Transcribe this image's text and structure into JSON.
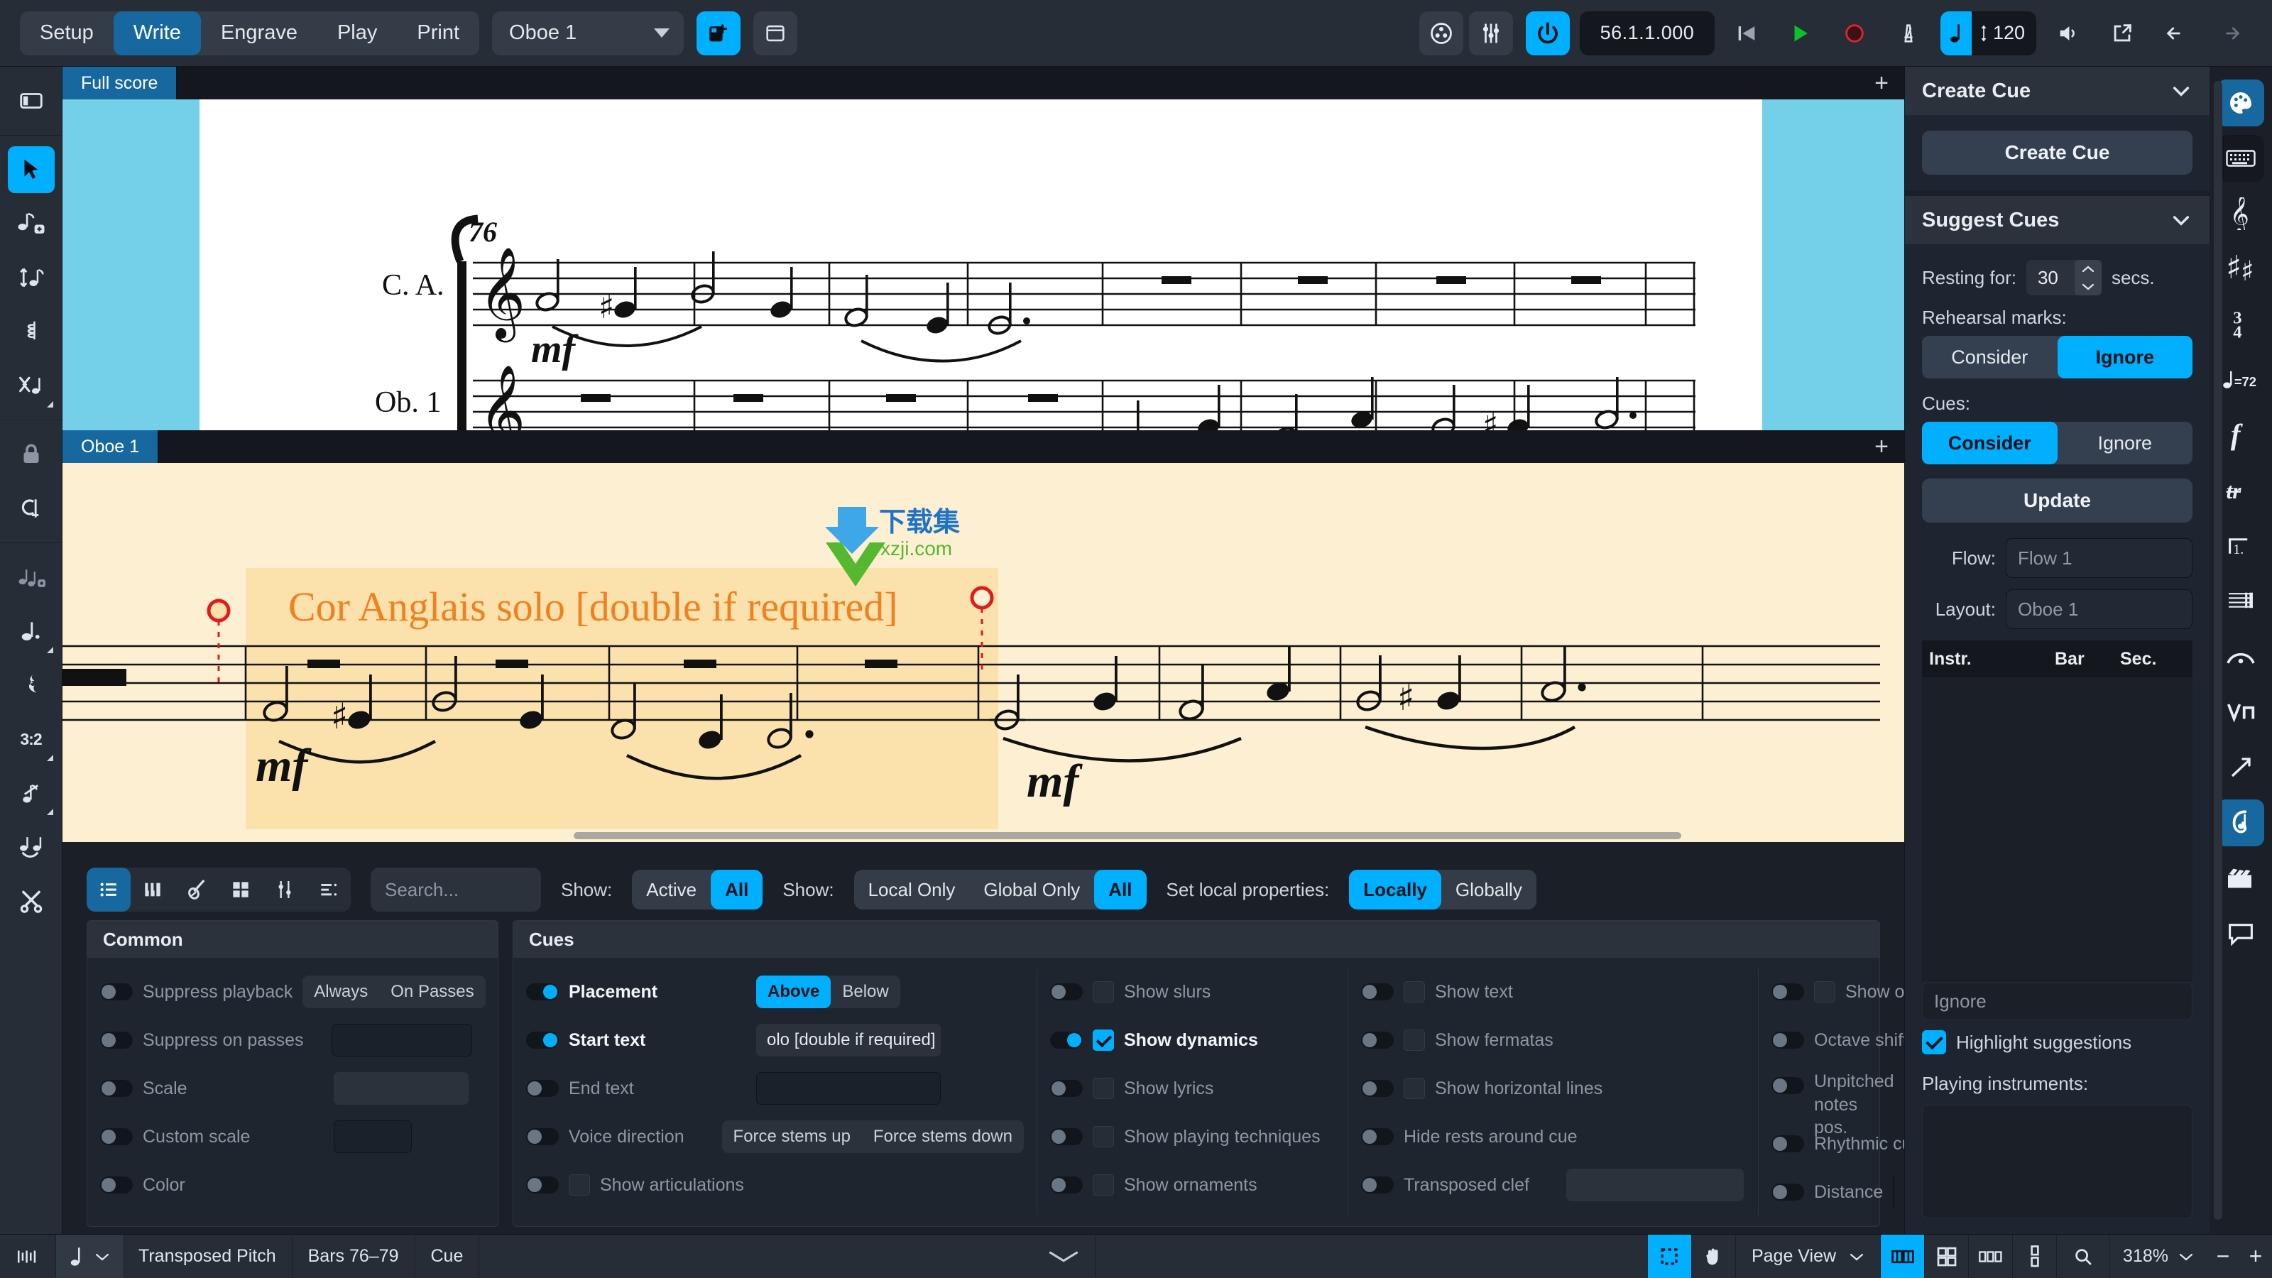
{
  "toolbar": {
    "modes": [
      {
        "label": "Setup",
        "active": false
      },
      {
        "label": "Write",
        "active": true
      },
      {
        "label": "Engrave",
        "active": false
      },
      {
        "label": "Play",
        "active": false
      },
      {
        "label": "Print",
        "active": false
      }
    ],
    "instrument_selector": "Oboe 1",
    "icons": {
      "new_tab": "new-tab-icon",
      "window": "window-icon",
      "mixer": "mixer-reel-icon",
      "faders": "faders-icon",
      "power": "playback-power-icon",
      "rewind": "rewind-icon",
      "play": "play-icon",
      "record": "record-icon",
      "metronome": "metronome-icon",
      "volume": "volume-icon",
      "export": "export-icon",
      "undo": "undo-icon",
      "redo": "redo-icon"
    },
    "timecode": "56.1.1.000",
    "tempo": "120"
  },
  "left_toolbar": {
    "items": [
      {
        "name": "panel-toggle-icon",
        "label": "Show left panel",
        "active": false
      },
      {
        "name": "select-arrow-icon",
        "label": "Select tool",
        "active": true
      },
      {
        "name": "note-input-icon",
        "label": "Note input",
        "active": false
      },
      {
        "name": "pitch-adjust-icon",
        "label": "Pitch before duration",
        "active": false
      },
      {
        "name": "chord-icon",
        "label": "Chord mode",
        "active": false
      },
      {
        "name": "voice-icon",
        "label": "Voice",
        "active": false
      },
      {
        "name": "lock-duration-icon",
        "label": "Lock duration",
        "active": false
      },
      {
        "name": "insert-icon",
        "label": "Insert mode",
        "active": false
      },
      {
        "name": "grace-note-icon",
        "label": "Grace note",
        "active": false
      },
      {
        "name": "dotted-note-icon",
        "label": "Note duration",
        "active": false
      },
      {
        "name": "rest-icon",
        "label": "Rest",
        "active": false
      },
      {
        "name": "tuplet-icon",
        "label": "3:2",
        "active": false
      },
      {
        "name": "slashed-grace-icon",
        "label": "Slashed grace note",
        "active": false
      },
      {
        "name": "tie-icon",
        "label": "Tie notes",
        "active": false
      },
      {
        "name": "scissors-icon",
        "label": "Split/cut",
        "active": false
      }
    ],
    "tuplet_label": "3:2"
  },
  "score_panes": [
    {
      "tab": "Full score",
      "staves": [
        {
          "name": "C. A.",
          "label": "Cor Anglais"
        },
        {
          "name": "Ob. 1",
          "label": "Oboe 1"
        }
      ],
      "bar_number": "76",
      "dynamics": [
        "mf",
        "mf"
      ],
      "selection_color": "#74cfe8"
    },
    {
      "tab": "Oboe 1",
      "cue_text": "Cor Anglais solo [double if required]",
      "cue_text_color": "#f08020",
      "dynamics": [
        "mf",
        "mf"
      ],
      "highlight_color": "#fdf0d2",
      "cue_highlight_color": "#fbe2ad",
      "watermark": {
        "cn": "下载集",
        "url": "xzji.com"
      }
    }
  ],
  "properties_toolbar": {
    "filter_icons": [
      {
        "name": "list-view-icon",
        "active": true
      },
      {
        "name": "piano-keys-icon",
        "active": false
      },
      {
        "name": "guitar-icon",
        "active": false
      },
      {
        "name": "grid-view-icon",
        "active": false
      },
      {
        "name": "faders-icon",
        "active": false
      },
      {
        "name": "outline-icon",
        "active": false
      }
    ],
    "search_placeholder": "Search...",
    "show_label_1": "Show:",
    "show_group_1": [
      {
        "label": "Active",
        "on": false
      },
      {
        "label": "All",
        "on": true
      }
    ],
    "show_label_2": "Show:",
    "show_group_2": [
      {
        "label": "Local Only",
        "on": false
      },
      {
        "label": "Global Only",
        "on": false
      },
      {
        "label": "All",
        "on": true
      }
    ],
    "set_local_label": "Set local properties:",
    "set_local_group": [
      {
        "label": "Locally",
        "on": true
      },
      {
        "label": "Globally",
        "on": false
      }
    ]
  },
  "common_panel": {
    "title": "Common",
    "rows": [
      {
        "label": "Suppress playback",
        "on": false,
        "control": "segmented",
        "options": [
          "Always",
          "On Passes"
        ]
      },
      {
        "label": "Suppress on passes",
        "on": false,
        "control": "field",
        "value": ""
      },
      {
        "label": "Scale",
        "on": false,
        "control": "fieldfill",
        "value": ""
      },
      {
        "label": "Custom scale",
        "on": false,
        "control": "fieldsm",
        "value": ""
      },
      {
        "label": "Color",
        "on": false,
        "control": "none",
        "value": ""
      }
    ]
  },
  "cues_panel": {
    "title": "Cues",
    "col1": [
      {
        "label": "Placement",
        "on": true,
        "control": "segmented",
        "options": [
          "Above",
          "Below"
        ],
        "selected": "Above"
      },
      {
        "label": "Start text",
        "on": true,
        "control": "textfield",
        "value": "olo [double if required]"
      },
      {
        "label": "End text",
        "on": false,
        "control": "field",
        "value": ""
      },
      {
        "label": "Voice direction",
        "on": false,
        "control": "segmented",
        "options": [
          "Force stems up",
          "Force stems down"
        ],
        "selected": ""
      },
      {
        "label": "Show articulations",
        "on": false,
        "control": "checkbox",
        "checked": false
      }
    ],
    "col2": [
      {
        "label": "Show slurs",
        "on": false,
        "checked": false
      },
      {
        "label": "Show dynamics",
        "on": true,
        "checked": true
      },
      {
        "label": "Show lyrics",
        "on": false,
        "checked": false
      },
      {
        "label": "Show playing techniques",
        "on": false,
        "checked": false
      },
      {
        "label": "Show ornaments",
        "on": false,
        "checked": false
      }
    ],
    "col3": [
      {
        "label": "Show text",
        "on": false,
        "checked": false,
        "has_checkbox": true
      },
      {
        "label": "Show fermatas",
        "on": false,
        "checked": false,
        "has_checkbox": true
      },
      {
        "label": "Show horizontal lines",
        "on": false,
        "checked": false,
        "has_checkbox": true
      },
      {
        "label": "Hide rests around cue",
        "on": false,
        "has_checkbox": false
      },
      {
        "label": "Transposed clef",
        "on": false,
        "has_checkbox": false,
        "control": "fieldfill"
      }
    ],
    "col4": [
      {
        "label": "Show octave transp",
        "on": false,
        "checked": false,
        "has_checkbox": true
      },
      {
        "label": "Octave shift",
        "on": false,
        "has_checkbox": false,
        "control": "field"
      },
      {
        "label": "Unpitched notes pos.",
        "on": false,
        "has_checkbox": false,
        "control": "field"
      },
      {
        "label": "Rhythmic cue",
        "on": false,
        "has_checkbox": false
      },
      {
        "label": "Distance",
        "on": false,
        "has_checkbox": false,
        "control": "field"
      }
    ]
  },
  "right_panel": {
    "create_cue": {
      "title": "Create Cue",
      "button": "Create Cue"
    },
    "suggest_cues": {
      "title": "Suggest Cues",
      "resting_label": "Resting for:",
      "resting_value": "30",
      "resting_unit": "secs.",
      "rehearsal_label": "Rehearsal marks:",
      "rehearsal_options": [
        {
          "label": "Consider",
          "on": false
        },
        {
          "label": "Ignore",
          "on": true
        }
      ],
      "cues_label": "Cues:",
      "cues_options": [
        {
          "label": "Consider",
          "on": true
        },
        {
          "label": "Ignore",
          "on": false
        }
      ],
      "update_button": "Update",
      "flow_label": "Flow:",
      "flow_value": "Flow 1",
      "layout_label": "Layout:",
      "layout_value": "Oboe 1",
      "table_headers": [
        "Instr.",
        "Bar",
        "Sec."
      ],
      "table_rows": [],
      "ignore_field": "Ignore",
      "highlight_label": "Highlight suggestions",
      "highlight_checked": true,
      "playing_label": "Playing instruments:"
    }
  },
  "right_rail": {
    "items": [
      {
        "name": "palette-icon",
        "active": true
      },
      {
        "name": "keyboard-icon",
        "active": false,
        "dark": true
      },
      {
        "name": "clef-icon",
        "active": false
      },
      {
        "name": "key-signature-icon",
        "active": false
      },
      {
        "name": "time-signature-icon",
        "active": false
      },
      {
        "name": "tempo-icon",
        "active": false,
        "label": "=72"
      },
      {
        "name": "dynamics-icon",
        "active": false
      },
      {
        "name": "ornaments-icon",
        "active": false
      },
      {
        "name": "repeat-structures-icon",
        "active": false
      },
      {
        "name": "barlines-icon",
        "active": false
      },
      {
        "name": "slurs-icon",
        "active": false
      },
      {
        "name": "playing-techniques-icon",
        "active": false
      },
      {
        "name": "lines-icon",
        "active": false
      },
      {
        "name": "cues-icon",
        "active": true
      },
      {
        "name": "video-icon",
        "active": false
      },
      {
        "name": "comments-icon",
        "active": false
      }
    ]
  },
  "status_bar": {
    "pitch_icon": "note-ruler-icon",
    "note_value_icon": "quarter-note-icon",
    "transposed_pitch": "Transposed Pitch",
    "bars": "Bars 76–79",
    "selection_type": "Cue",
    "marquee_icon": "marquee-select-icon",
    "hand_icon": "hand-tool-icon",
    "view_mode": "Page View",
    "layout_icons": [
      {
        "name": "spreads-view-icon",
        "active": true
      },
      {
        "name": "two-by-two-view-icon",
        "active": false
      },
      {
        "name": "horizontal-view-icon",
        "active": false
      },
      {
        "name": "vertical-view-icon",
        "active": false
      }
    ],
    "zoom_icon": "magnifier-icon",
    "zoom_value": "318%",
    "zoom_minus": "−",
    "zoom_plus": "+"
  }
}
